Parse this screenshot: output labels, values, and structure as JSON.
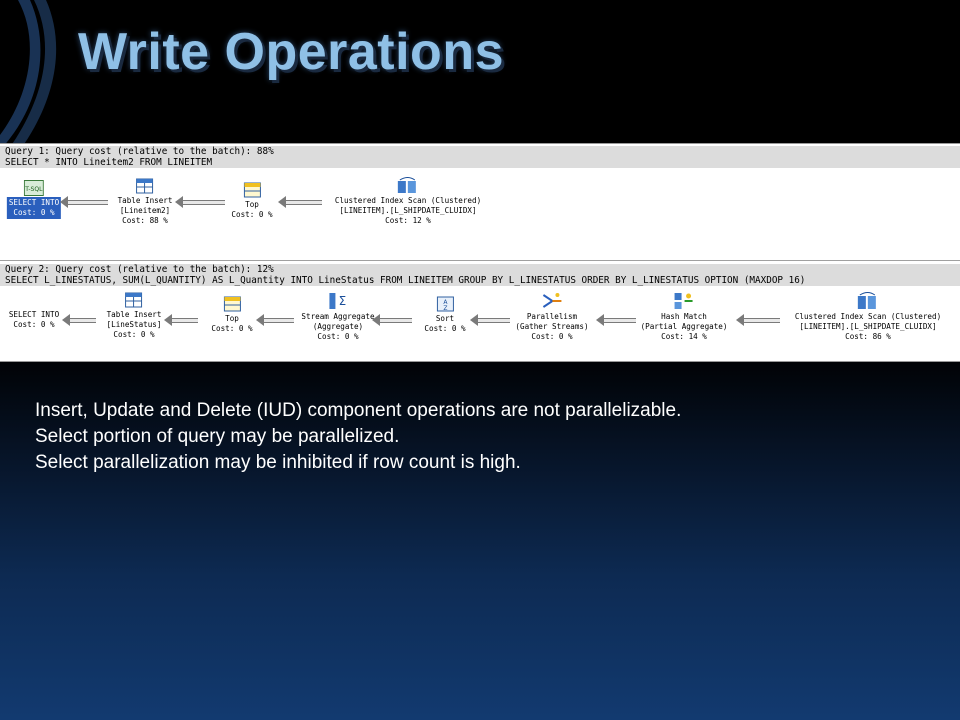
{
  "slide": {
    "title": "Write Operations",
    "bullets": [
      "Insert, Update and Delete (IUD) component operations are not parallelizable.",
      "Select portion of query may be parallelized.",
      "Select parallelization may be inhibited if row count is high."
    ]
  },
  "query1": {
    "header": "Query 1: Query cost (relative to the batch): 88%",
    "sql": "SELECT * INTO Lineitem2 FROM LINEITEM",
    "nodes": [
      {
        "icon": "tsql-icon",
        "lines": [
          "SELECT INTO",
          "Cost: 0 %"
        ]
      },
      {
        "icon": "table-insert-icon",
        "lines": [
          "Table Insert",
          "[Lineitem2]",
          "Cost: 88 %"
        ]
      },
      {
        "icon": "top-icon",
        "lines": [
          "Top",
          "Cost: 0 %"
        ]
      },
      {
        "icon": "clustered-index-scan-icon",
        "lines": [
          "Clustered Index Scan (Clustered)",
          "[LINEITEM].[L_SHIPDATE_CLUIDX]",
          "Cost: 12 %"
        ]
      }
    ]
  },
  "query2": {
    "header": "Query 2: Query cost (relative to the batch): 12%",
    "sql": "SELECT L_LINESTATUS, SUM(L_QUANTITY) AS L_Quantity INTO LineStatus FROM LINEITEM GROUP BY L_LINESTATUS ORDER BY L_LINESTATUS OPTION (MAXDOP 16)",
    "nodes": [
      {
        "icon": "select-icon",
        "lines": [
          "SELECT INTO",
          "Cost: 0 %"
        ]
      },
      {
        "icon": "table-insert-icon",
        "lines": [
          "Table Insert",
          "[LineStatus]",
          "Cost: 0 %"
        ]
      },
      {
        "icon": "top-icon",
        "lines": [
          "Top",
          "Cost: 0 %"
        ]
      },
      {
        "icon": "stream-aggregate-icon",
        "lines": [
          "Stream Aggregate",
          "(Aggregate)",
          "Cost: 0 %"
        ]
      },
      {
        "icon": "sort-icon",
        "lines": [
          "Sort",
          "Cost: 0 %"
        ]
      },
      {
        "icon": "parallelism-icon",
        "lines": [
          "Parallelism",
          "(Gather Streams)",
          "Cost: 0 %"
        ]
      },
      {
        "icon": "hash-match-icon",
        "lines": [
          "Hash Match",
          "(Partial Aggregate)",
          "Cost: 14 %"
        ]
      },
      {
        "icon": "clustered-index-scan-icon",
        "lines": [
          "Clustered Index Scan (Clustered)",
          "[LINEITEM].[L_SHIPDATE_CLUIDX]",
          "Cost: 86 %"
        ]
      }
    ]
  },
  "colors": {
    "title": "#8fc0e6",
    "selection": "#2a5fbd",
    "header_bg": "#dcdcdc"
  }
}
